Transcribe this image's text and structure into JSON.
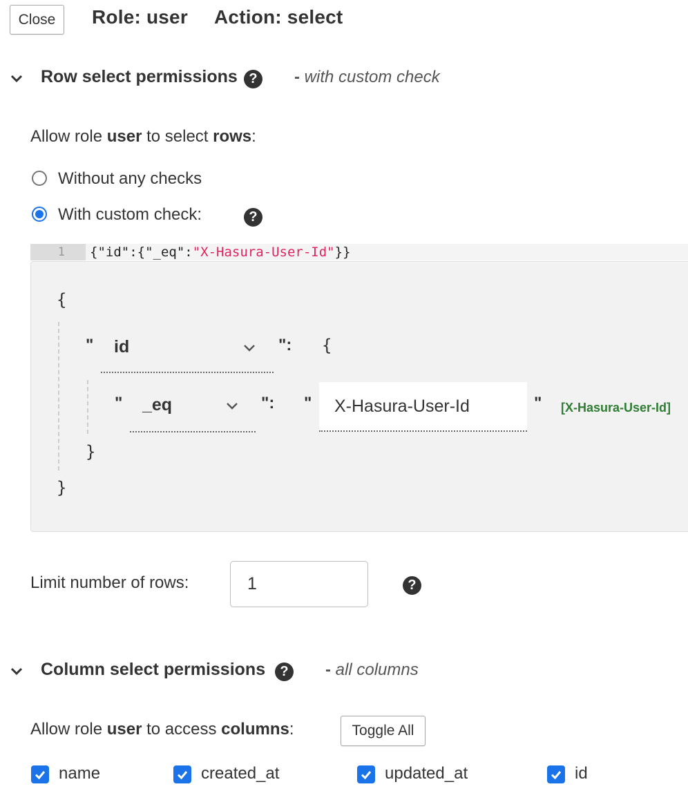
{
  "header": {
    "close_label": "Close",
    "role_title": "Role: user",
    "action_title": "Action: select"
  },
  "row_section": {
    "title": "Row select permissions",
    "note_prefix": "-",
    "note": "with custom check",
    "allow_prefix": "Allow role ",
    "allow_role": "user",
    "allow_mid": " to select ",
    "allow_obj": "rows",
    "allow_suffix": ":",
    "options": [
      {
        "label": "Without any checks",
        "selected": false
      },
      {
        "label": "With custom check:",
        "selected": true
      }
    ],
    "editor": {
      "line_number": "1",
      "code_prefix": "{\"id\":{\"_eq\":",
      "code_string": "\"X-Hasura-User-Id\"",
      "code_suffix": "}}"
    },
    "builder": {
      "open_brace": "{",
      "close_brace": "}",
      "quote": "\"",
      "colon": "\":",
      "column_select": "id",
      "inner_open": "{",
      "inner_close": "}",
      "operator_select": "_eq",
      "value_input": "X-Hasura-User-Id",
      "resolved_value": "[X-Hasura-User-Id]"
    },
    "limit_label": "Limit number of rows:",
    "limit_value": "1"
  },
  "column_section": {
    "title": "Column select permissions",
    "note_prefix": "-",
    "note": "all columns",
    "allow_prefix": "Allow role ",
    "allow_role": "user",
    "allow_mid": " to access ",
    "allow_obj": "columns",
    "allow_suffix": ":",
    "toggle_all_label": "Toggle All",
    "columns": [
      {
        "name": "name",
        "checked": true
      },
      {
        "name": "created_at",
        "checked": true
      },
      {
        "name": "updated_at",
        "checked": true
      },
      {
        "name": "id",
        "checked": true
      }
    ]
  },
  "colors": {
    "accent": "#1a73e8",
    "string": "#e0245e",
    "resolved": "#2e7d32"
  }
}
